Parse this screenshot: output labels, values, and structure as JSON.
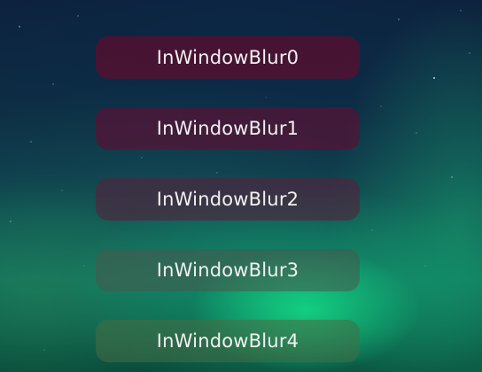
{
  "window": {
    "background": "aurora-night-sky"
  },
  "panels": [
    {
      "label": "InWindowBlur0",
      "tint": "#580e2e"
    },
    {
      "label": "InWindowBlur1",
      "tint": "#561234"
    },
    {
      "label": "InWindowBlur2",
      "tint": "#54223c"
    },
    {
      "label": "InWindowBlur3",
      "tint": "#48584c"
    },
    {
      "label": "InWindowBlur4",
      "tint": "#466e46"
    }
  ]
}
